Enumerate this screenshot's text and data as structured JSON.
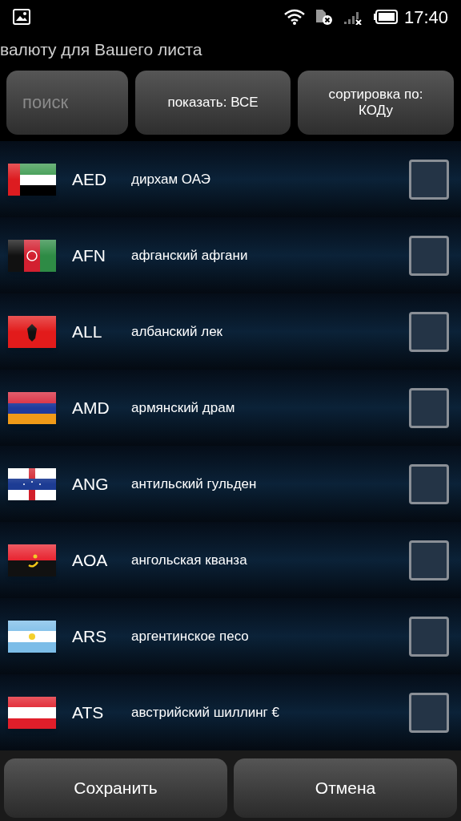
{
  "status_bar": {
    "time": "17:40"
  },
  "header": {
    "title": "валюту для Вашего листа"
  },
  "toolbar": {
    "search": {
      "placeholder": "поиск"
    },
    "filter_button": "показать: ВСЕ",
    "sort_button": "сортировка по: КОДу"
  },
  "currencies": [
    {
      "code": "AED",
      "name": "дирхам ОАЭ",
      "kind": "uae",
      "checked": false
    },
    {
      "code": "AFN",
      "name": "афганский афгани",
      "kind": "afghanistan",
      "checked": false
    },
    {
      "code": "ALL",
      "name": "албанский лек",
      "kind": "albania",
      "checked": false
    },
    {
      "code": "AMD",
      "name": "армянский драм",
      "kind": "armenia",
      "checked": false
    },
    {
      "code": "ANG",
      "name": "антильский гульден",
      "kind": "antilles",
      "checked": false
    },
    {
      "code": "AOA",
      "name": "ангольская кванза",
      "kind": "angola",
      "checked": false
    },
    {
      "code": "ARS",
      "name": "аргентинское песо",
      "kind": "argentina",
      "checked": false
    },
    {
      "code": "ATS",
      "name": "австрийский шиллинг €",
      "kind": "austria",
      "checked": false
    }
  ],
  "buttons": [
    "Сохранить",
    "Отмена"
  ]
}
